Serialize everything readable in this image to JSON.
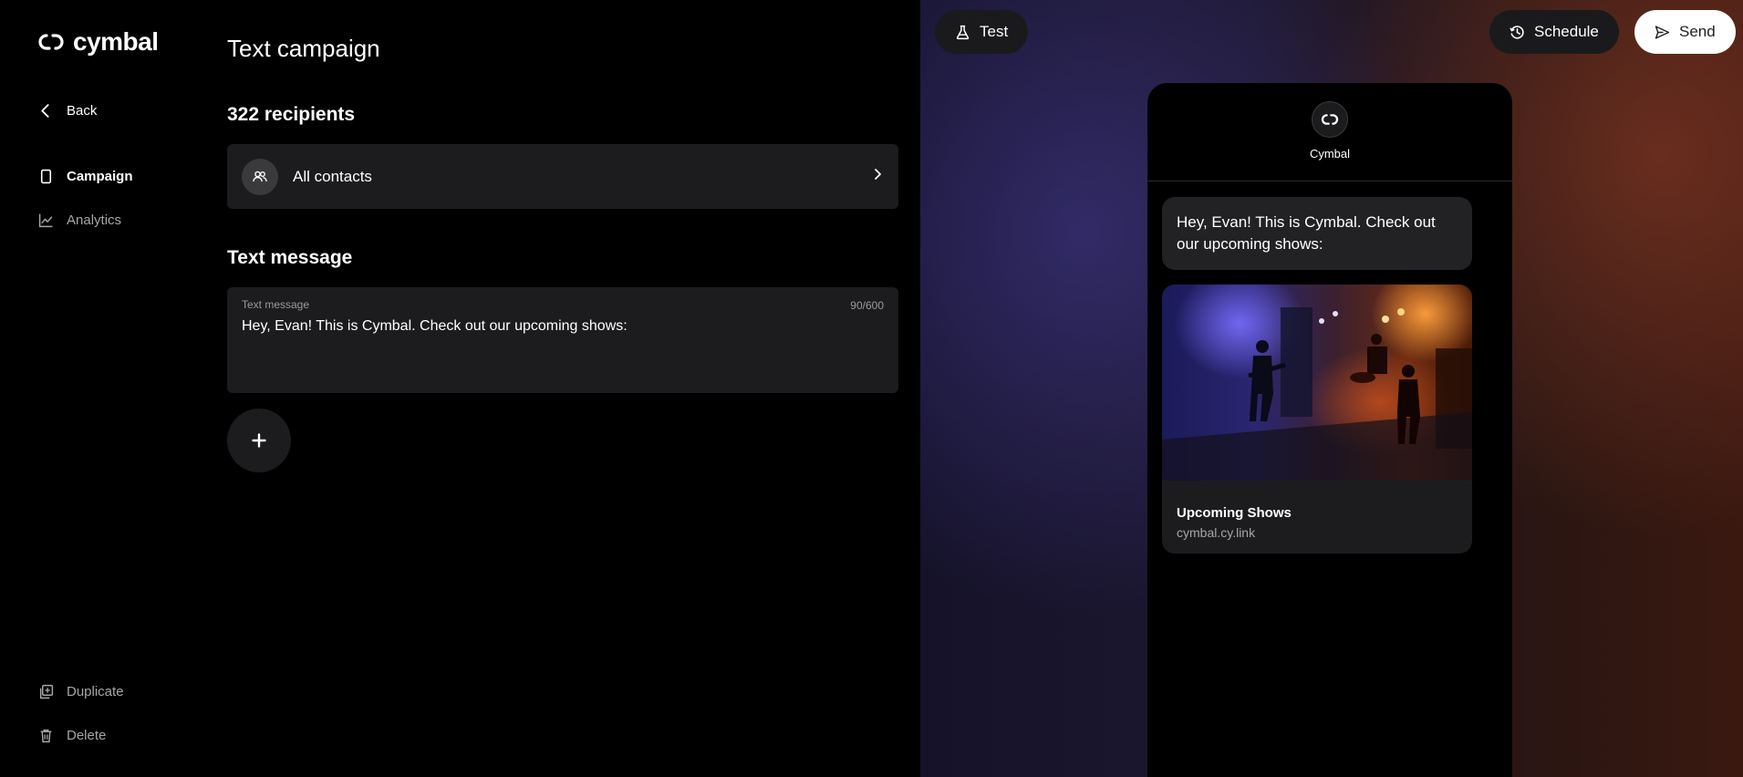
{
  "app": {
    "brand": "cymbal"
  },
  "sidebar": {
    "back_label": "Back",
    "items": [
      {
        "label": "Campaign",
        "icon": "phone-icon",
        "active": true
      },
      {
        "label": "Analytics",
        "icon": "chart-icon",
        "active": false
      }
    ],
    "duplicate_label": "Duplicate",
    "delete_label": "Delete"
  },
  "main": {
    "title": "Text campaign",
    "recipients_title": "322 recipients",
    "contacts_label": "All contacts",
    "message_section_title": "Text message",
    "message_field_label": "Text message",
    "message_count": "90/600",
    "message_value": "Hey, Evan! This is Cymbal. Check out our upcoming shows:"
  },
  "toolbar": {
    "test_label": "Test",
    "schedule_label": "Schedule",
    "send_label": "Send"
  },
  "preview": {
    "sender_name": "Cymbal",
    "bubble_text": "Hey, Evan! This is Cymbal. Check out our upcoming shows:",
    "card_title": "Upcoming Shows",
    "card_link": "cymbal.cy.link"
  },
  "colors": {
    "panel": "#1c1c1e",
    "muted_text": "#a6a6a6",
    "send_bg": "#ffffff"
  }
}
